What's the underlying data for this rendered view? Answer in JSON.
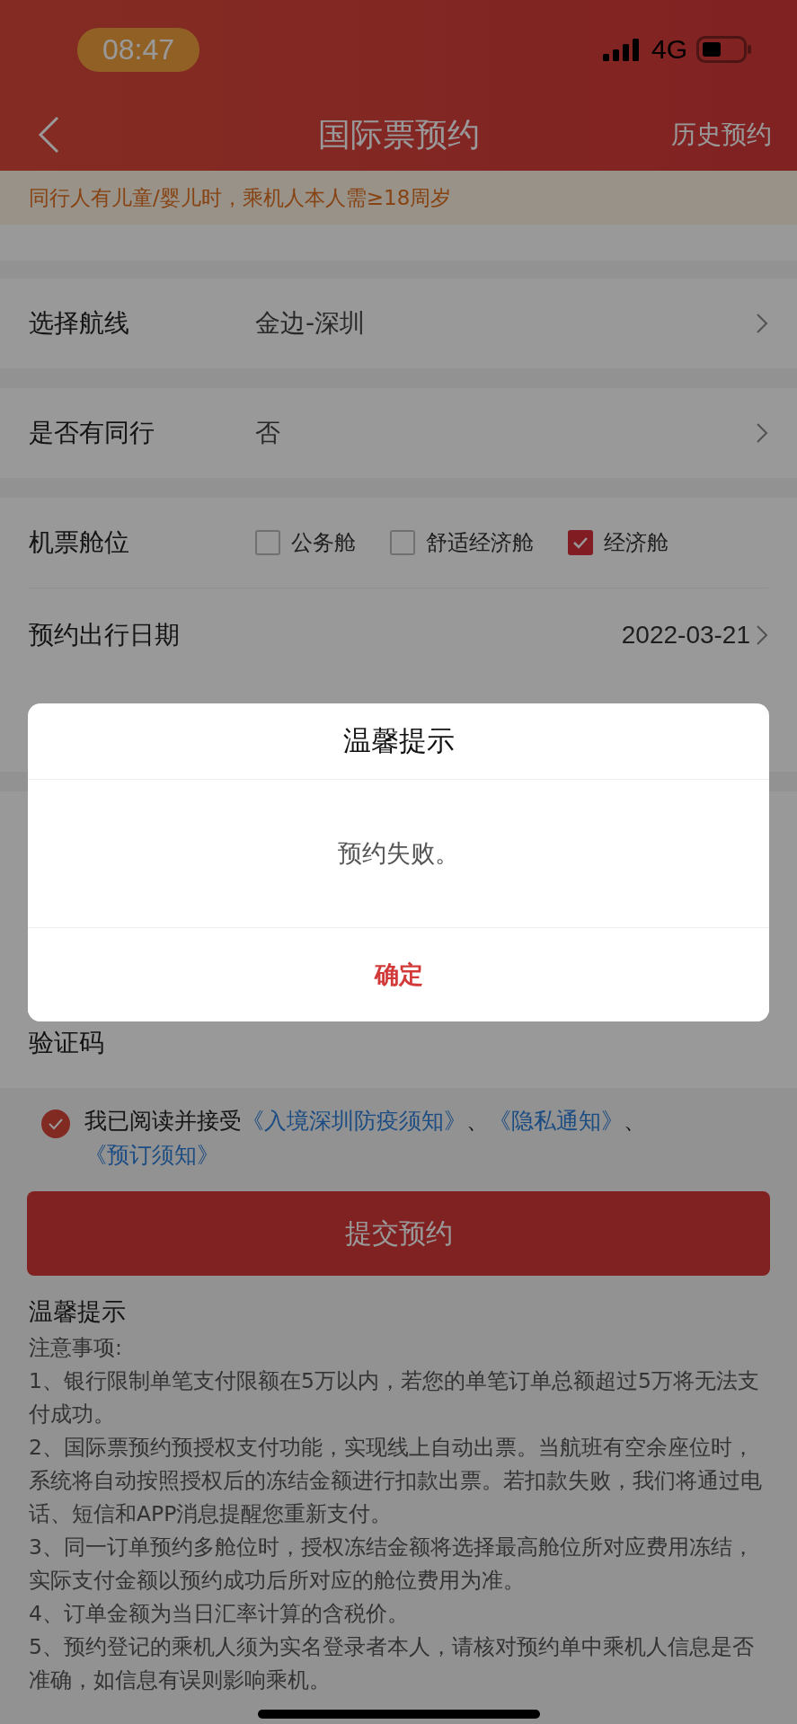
{
  "status_bar": {
    "time": "08:47",
    "network": "4G"
  },
  "nav": {
    "title": "国际票预约",
    "action": "历史预约"
  },
  "notice": "同行人有儿童/婴儿时，乘机人本人需≥18周岁",
  "sections": [
    {
      "kind": "blank"
    },
    {
      "kind": "card",
      "rows": [
        {
          "kind": "select",
          "label": "选择航线",
          "value": "金边-深圳"
        }
      ]
    },
    {
      "kind": "card",
      "rows": [
        {
          "kind": "select",
          "label": "是否有同行",
          "value": "否"
        }
      ]
    },
    {
      "kind": "card",
      "rows": [
        {
          "kind": "checkboxes",
          "label": "机票舱位",
          "options": [
            {
              "label": "公务舱",
              "checked": false
            },
            {
              "label": "舒适经济舱",
              "checked": false
            },
            {
              "label": "经济舱",
              "checked": true
            }
          ]
        },
        {
          "kind": "date",
          "label": "预约出行日期",
          "value": "2022-03-21"
        }
      ]
    },
    {
      "kind": "covered",
      "rows": [
        {
          "kind": "code",
          "label": "验证码"
        }
      ]
    }
  ],
  "agreement": {
    "checked": true,
    "parts": [
      {
        "kind": "text",
        "text": "我已阅读并接受"
      },
      {
        "kind": "link",
        "text": "《入境深圳防疫须知》"
      },
      {
        "kind": "text",
        "text": "、"
      },
      {
        "kind": "link",
        "text": "《隐私通知》"
      },
      {
        "kind": "text",
        "text": "、"
      },
      {
        "kind": "link",
        "text": "《预订须知》"
      }
    ]
  },
  "submit_button": "提交预约",
  "tips": {
    "title": "温馨提示",
    "lines": [
      "注意事项:",
      "1、银行限制单笔支付限额在5万以内，若您的单笔订单总额超过5万将无法支付成功。",
      "2、国际票预约预授权支付功能，实现线上自动出票。当航班有空余座位时，系统将自动按照授权后的冻结金额进行扣款出票。若扣款失败，我们将通过电话、短信和APP消息提醒您重新支付。",
      "3、同一订单预约多舱位时，授权冻结金额将选择最高舱位所对应费用冻结，实际支付金额以预约成功后所对应的舱位费用为准。",
      "4、订单金额为当日汇率计算的含税价。",
      "5、预约登记的乘机人须为实名登录者本人，请核对预约单中乘机人信息是否准确，如信息有误则影响乘机。"
    ]
  },
  "dialog": {
    "title": "温馨提示",
    "message": "预约失败。",
    "button": "确定"
  }
}
